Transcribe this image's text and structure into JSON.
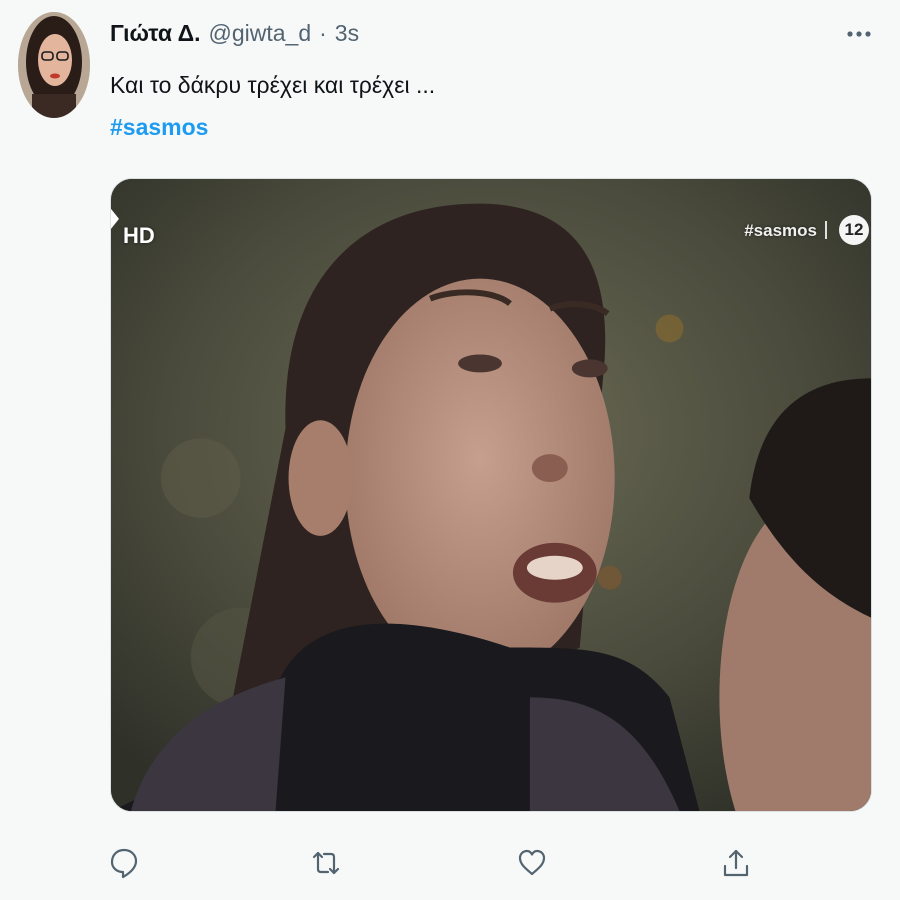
{
  "tweet": {
    "author": {
      "display_name": "Γιώτα Δ.",
      "handle": "@giwta_d",
      "separator": "·",
      "time": "3s"
    },
    "text": "Και το δάκρυ τρέχει και τρέχει ...",
    "hashtag": "#sasmos",
    "media": {
      "hd_label": "HD",
      "channel_tag": "#sasmos",
      "channel_logo": "12"
    },
    "actions": {
      "reply_icon": "reply-icon",
      "retweet_icon": "retweet-icon",
      "like_icon": "heart-icon",
      "share_icon": "share-icon"
    },
    "colors": {
      "link": "#1d9bf0",
      "secondary_text": "#536471",
      "background": "#f7f9f9"
    }
  }
}
